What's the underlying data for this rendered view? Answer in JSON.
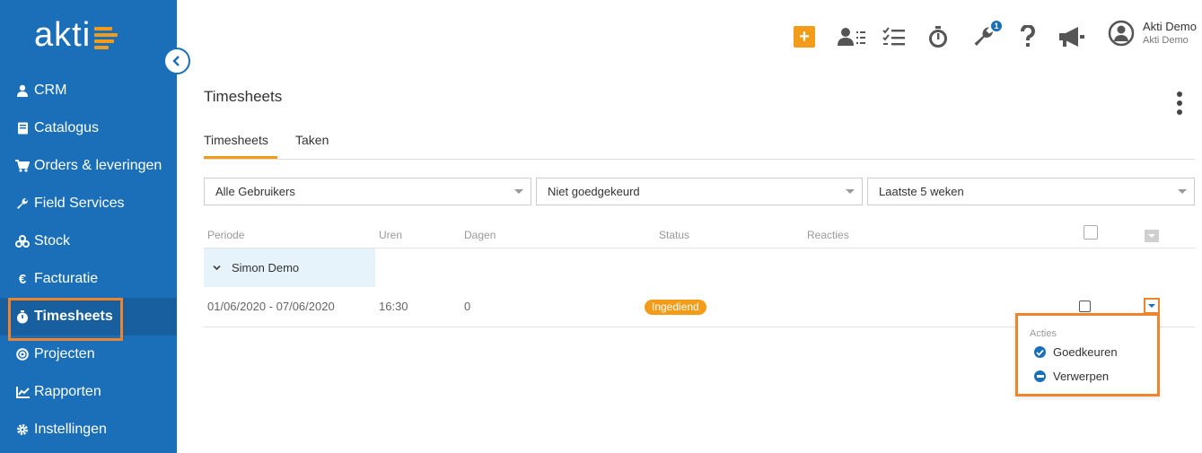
{
  "brand": {
    "logo_text": "akti",
    "accent_color": "#f39c1a",
    "primary_color": "#1b6fb8",
    "highlight_color": "#f0842c"
  },
  "sidebar": {
    "items": [
      {
        "label": "CRM",
        "icon": "user-icon"
      },
      {
        "label": "Catalogus",
        "icon": "book-icon"
      },
      {
        "label": "Orders & leveringen",
        "icon": "cart-icon"
      },
      {
        "label": "Field Services",
        "icon": "wrench-icon"
      },
      {
        "label": "Stock",
        "icon": "boxes-icon"
      },
      {
        "label": "Facturatie",
        "icon": "euro-icon"
      },
      {
        "label": "Timesheets",
        "icon": "stopwatch-icon",
        "active": true
      },
      {
        "label": "Projecten",
        "icon": "target-icon"
      },
      {
        "label": "Rapporten",
        "icon": "chart-icon"
      },
      {
        "label": "Instellingen",
        "icon": "gear-icon"
      }
    ]
  },
  "topbar": {
    "plus_label": "+",
    "notification_count": "1",
    "user": {
      "name": "Akti Demo",
      "company": "Akti Demo"
    }
  },
  "page": {
    "title": "Timesheets",
    "tabs": [
      {
        "label": "Timesheets",
        "active": true
      },
      {
        "label": "Taken"
      }
    ]
  },
  "filters": {
    "users": "Alle Gebruikers",
    "approval": "Niet goedgekeurd",
    "period": "Laatste 5 weken"
  },
  "table": {
    "columns": [
      "Periode",
      "Uren",
      "Dagen",
      "Status",
      "Reacties"
    ],
    "group": "Simon Demo",
    "rows": [
      {
        "periode": "01/06/2020 - 07/06/2020",
        "uren": "16:30",
        "dagen": "0",
        "status": "Ingediend"
      }
    ]
  },
  "actions_menu": {
    "header": "Acties",
    "items": [
      {
        "label": "Goedkeuren",
        "icon": "check-circle-icon"
      },
      {
        "label": "Verwerpen",
        "icon": "minus-circle-icon"
      }
    ]
  }
}
